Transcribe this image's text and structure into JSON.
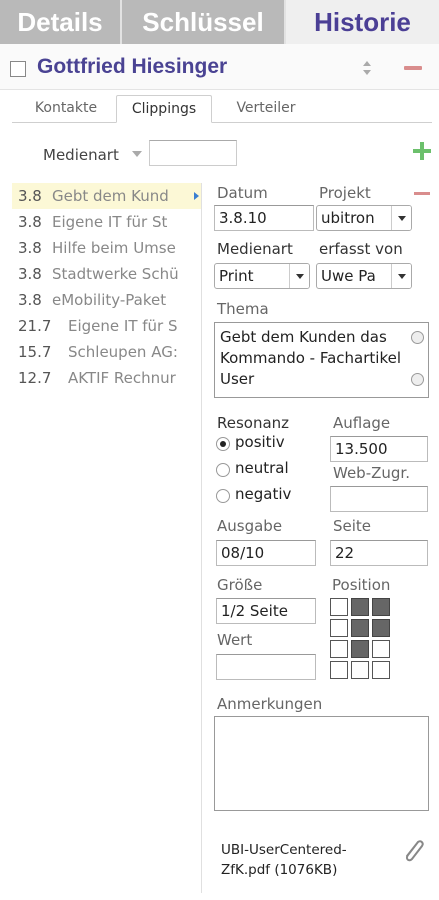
{
  "header": {
    "tabs": [
      {
        "label": "Details"
      },
      {
        "label": "Schlüssel"
      },
      {
        "label": "Historie"
      }
    ]
  },
  "person": {
    "name": "Gottfried Hiesinger"
  },
  "subtabs": [
    {
      "label": "Kontakte"
    },
    {
      "label": "Clippings"
    },
    {
      "label": "Verteiler"
    }
  ],
  "filter": {
    "label": "Medienart",
    "value": ""
  },
  "clippings": [
    {
      "date": "3.8",
      "title": "Gebt dem Kund"
    },
    {
      "date": "3.8",
      "title": "Eigene IT für St"
    },
    {
      "date": "3.8",
      "title": "Hilfe beim Umse"
    },
    {
      "date": "3.8",
      "title": "Stadtwerke Schü"
    },
    {
      "date": "3.8",
      "title": "eMobility-Paket"
    },
    {
      "date": "21.7",
      "title": "Eigene IT für S"
    },
    {
      "date": "15.7",
      "title": "Schleupen AG:"
    },
    {
      "date": "12.7",
      "title": "AKTIF Rechnur"
    }
  ],
  "detail": {
    "datum_label": "Datum",
    "datum_value": "3.8.10",
    "projekt_label": "Projekt",
    "projekt_value": "ubitron",
    "medienart_label": "Medienart",
    "medienart_value": "Print",
    "erfasst_label": "erfasst von",
    "erfasst_value": "Uwe Pa",
    "thema_label": "Thema",
    "thema_value": "Gebt dem Kunden das Kommando - Fachartikel User",
    "resonanz_label": "Resonanz",
    "resonanz_options": [
      "positiv",
      "neutral",
      "negativ"
    ],
    "resonanz_selected": "positiv",
    "auflage_label": "Auflage",
    "auflage_value": "13.500",
    "webzugr_label": "Web-Zugr.",
    "webzugr_value": "",
    "ausgabe_label": "Ausgabe",
    "ausgabe_value": "08/10",
    "seite_label": "Seite",
    "seite_value": "22",
    "groesse_label": "Größe",
    "groesse_value": "1/2 Seite",
    "position_label": "Position",
    "position_grid": [
      [
        0,
        1,
        1
      ],
      [
        0,
        1,
        1
      ],
      [
        0,
        1,
        0
      ],
      [
        0,
        0,
        0
      ]
    ],
    "wert_label": "Wert",
    "wert_value": "",
    "anmerkungen_label": "Anmerkungen",
    "anmerkungen_value": "",
    "attachment_line1": "UBI-UserCentered-",
    "attachment_line2": "ZfK.pdf (1076KB)"
  },
  "colors": {
    "brand_purple": "#4a4393",
    "add_green": "#6cc06c",
    "remove_red": "#d98d8d",
    "selection_yellow": "#fcf8d6"
  }
}
